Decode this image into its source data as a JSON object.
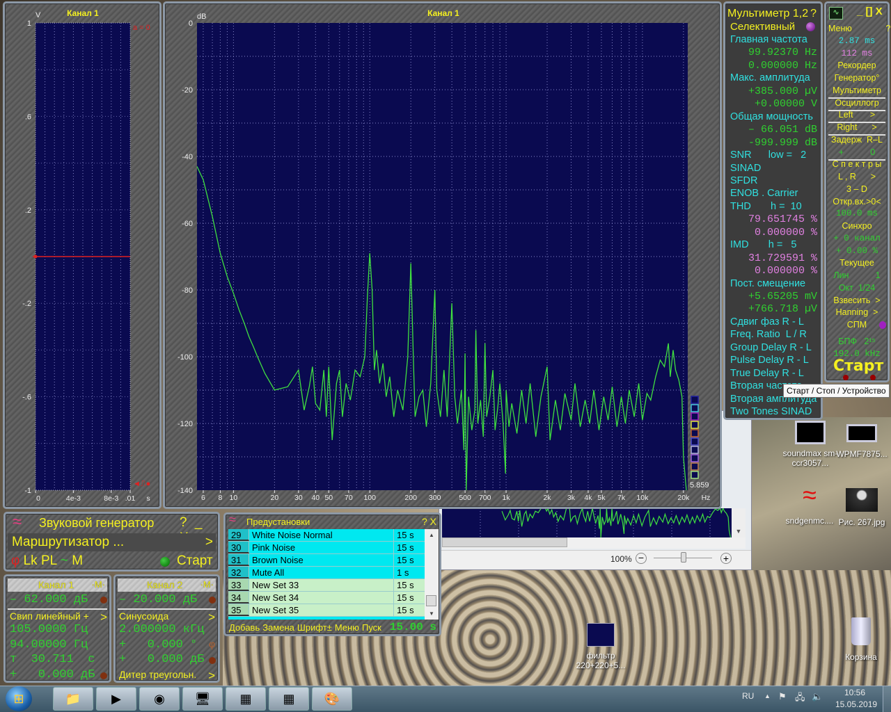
{
  "oscilloscope": {
    "title": "Канал 1",
    "unit_y": "V",
    "unit_x": "s",
    "y_ticks": [
      "1",
      ".6",
      ".2",
      "-.2",
      "-.6",
      "-1"
    ],
    "x_ticks": [
      "0",
      "4e-3",
      "8e-3",
      ".01"
    ],
    "trigger_label": "a = 0",
    "marker_label": "◄⎍●"
  },
  "spectrum": {
    "title": "Канал 1",
    "unit_y": "dB",
    "unit_x": "Hz",
    "y_ticks": [
      "0",
      "-20",
      "-40",
      "-60",
      "-80",
      "-100",
      "-120",
      "-140"
    ],
    "x_ticks": [
      "6",
      "8",
      "10",
      "20",
      "30",
      "40",
      "50",
      "70",
      "100",
      "200",
      "300",
      "500",
      "700",
      "1k",
      "2k",
      "3k",
      "4k",
      "5k",
      "7k",
      "10k",
      "20k"
    ],
    "corner_value": "5.859",
    "legend_colors": [
      "#2020a0",
      "#40c0e0",
      "#a020c0",
      "#e0e040",
      "#c06030",
      "#5050d0",
      "#b0b0e0",
      "#a060e0",
      "#c08050",
      "#a0e080"
    ]
  },
  "chart_data": {
    "type": "line",
    "title": "Канал 1",
    "ylabel": "dB",
    "xlabel": "Hz",
    "x_scale": "log",
    "xlim": [
      5.4,
      21500
    ],
    "ylim": [
      -140,
      0
    ],
    "grid": true,
    "line_color": "#40e040",
    "background": "#0a0a50",
    "points": [
      [
        5.4,
        -43
      ],
      [
        6,
        -47
      ],
      [
        7,
        -58
      ],
      [
        8,
        -69
      ],
      [
        9,
        -76
      ],
      [
        10,
        -81
      ],
      [
        11,
        -86
      ],
      [
        12,
        -90
      ],
      [
        13,
        -94
      ],
      [
        14,
        -97
      ],
      [
        15,
        -100
      ],
      [
        17,
        -105
      ],
      [
        20,
        -110
      ],
      [
        25,
        -109
      ],
      [
        30,
        -104
      ],
      [
        33,
        -116
      ],
      [
        36,
        -109
      ],
      [
        38,
        -103
      ],
      [
        40,
        -114
      ],
      [
        43,
        -116
      ],
      [
        46,
        -104
      ],
      [
        48,
        -118
      ],
      [
        50,
        -103
      ],
      [
        53,
        -125
      ],
      [
        57,
        -108
      ],
      [
        60,
        -104
      ],
      [
        63,
        -118
      ],
      [
        67,
        -108
      ],
      [
        72,
        -113
      ],
      [
        78,
        -104
      ],
      [
        85,
        -106
      ],
      [
        92,
        -100
      ],
      [
        96,
        -82
      ],
      [
        100,
        -69
      ],
      [
        104,
        -80
      ],
      [
        108,
        -104
      ],
      [
        112,
        -98
      ],
      [
        118,
        -108
      ],
      [
        125,
        -102
      ],
      [
        132,
        -112
      ],
      [
        140,
        -106
      ],
      [
        150,
        -118
      ],
      [
        160,
        -110
      ],
      [
        175,
        -116
      ],
      [
        190,
        -100
      ],
      [
        200,
        -72
      ],
      [
        208,
        -98
      ],
      [
        215,
        -118
      ],
      [
        230,
        -112
      ],
      [
        245,
        -110
      ],
      [
        260,
        -121
      ],
      [
        280,
        -108
      ],
      [
        300,
        -80
      ],
      [
        310,
        -110
      ],
      [
        330,
        -118
      ],
      [
        350,
        -104
      ],
      [
        370,
        -118
      ],
      [
        400,
        -84
      ],
      [
        420,
        -112
      ],
      [
        440,
        -120
      ],
      [
        470,
        -110
      ],
      [
        490,
        -128
      ],
      [
        500,
        -99
      ],
      [
        510,
        -140
      ],
      [
        530,
        -112
      ],
      [
        560,
        -122
      ],
      [
        590,
        -116
      ],
      [
        600,
        -92
      ],
      [
        620,
        -120
      ],
      [
        650,
        -113
      ],
      [
        680,
        -124
      ],
      [
        700,
        -96
      ],
      [
        720,
        -118
      ],
      [
        760,
        -112
      ],
      [
        800,
        -104
      ],
      [
        830,
        -122
      ],
      [
        870,
        -115
      ],
      [
        900,
        -108
      ],
      [
        950,
        -120
      ],
      [
        990,
        -135
      ],
      [
        1000,
        -110
      ],
      [
        1050,
        -121
      ],
      [
        1100,
        -114
      ],
      [
        1200,
        -123
      ],
      [
        1300,
        -110
      ],
      [
        1400,
        -120
      ],
      [
        1500,
        -108
      ],
      [
        1650,
        -124
      ],
      [
        1800,
        -112
      ],
      [
        2000,
        -103
      ],
      [
        2100,
        -125
      ],
      [
        2300,
        -113
      ],
      [
        2500,
        -122
      ],
      [
        2700,
        -111
      ],
      [
        3000,
        -119
      ],
      [
        3200,
        -108
      ],
      [
        3500,
        -121
      ],
      [
        3800,
        -113
      ],
      [
        4100,
        -120
      ],
      [
        4400,
        -110
      ],
      [
        4800,
        -122
      ],
      [
        5200,
        -112
      ],
      [
        5600,
        -119
      ],
      [
        6000,
        -109
      ],
      [
        6500,
        -121
      ],
      [
        7000,
        -112
      ],
      [
        7500,
        -120
      ],
      [
        8000,
        -110
      ],
      [
        8700,
        -118
      ],
      [
        9400,
        -108
      ],
      [
        10000,
        -119
      ],
      [
        10800,
        -111
      ],
      [
        11500,
        -113
      ],
      [
        12500,
        -106
      ],
      [
        13500,
        -101
      ],
      [
        14500,
        -103
      ],
      [
        15500,
        -96
      ],
      [
        16000,
        -106
      ],
      [
        16800,
        -98
      ],
      [
        17500,
        -104
      ],
      [
        18500,
        -107
      ],
      [
        19500,
        -112
      ],
      [
        20000,
        -130
      ],
      [
        21000,
        -142
      ]
    ]
  },
  "multimeter": {
    "title": "Мультиметр 1,2",
    "help": "?",
    "mode": "Селективный",
    "rows": [
      {
        "t": "Главная частота",
        "c": "c"
      },
      {
        "t": "99.92370 Hz",
        "c": "g",
        "v": 1
      },
      {
        "t": "0.000000 Hz",
        "c": "g",
        "v": 1
      },
      {
        "t": "Макс. амплитуда",
        "c": "c"
      },
      {
        "t": "+385.000 µV",
        "c": "g",
        "v": 1
      },
      {
        "t": "+0.00000 V",
        "c": "g",
        "v": 1
      },
      {
        "t": "Общая мощность",
        "c": "c"
      },
      {
        "t": "– 66.051 dB",
        "c": "g",
        "v": 1
      },
      {
        "t": "-999.999 dB",
        "c": "g",
        "v": 1
      },
      {
        "t": "SNR      low =   2",
        "c": "c"
      },
      {
        "t": "SINAD",
        "c": "c"
      },
      {
        "t": "SFDR",
        "c": "c"
      },
      {
        "t": "ENOB . Carrier",
        "c": "c"
      },
      {
        "t": "THD       h =  10",
        "c": "c"
      },
      {
        "t": "79.651745 %",
        "c": "p",
        "v": 1
      },
      {
        "t": "0.000000 %",
        "c": "p",
        "v": 1
      },
      {
        "t": "IMD       h =   5",
        "c": "c"
      },
      {
        "t": "31.729591 %",
        "c": "p",
        "v": 1
      },
      {
        "t": "0.000000 %",
        "c": "p",
        "v": 1
      },
      {
        "t": "Пост. смещение",
        "c": "c"
      },
      {
        "t": "+5.65205 mV",
        "c": "g",
        "v": 1
      },
      {
        "t": "+766.718 µV",
        "c": "g",
        "v": 1
      },
      {
        "t": "Сдвиг фаз R - L",
        "c": "c"
      },
      {
        "t": "Freq. Ratio  L / R",
        "c": "c"
      },
      {
        "t": "Group Delay R - L",
        "c": "c"
      },
      {
        "t": "Pulse Delay R - L",
        "c": "c"
      },
      {
        "t": "True Delay R - L",
        "c": "c"
      },
      {
        "t": "Вторая частота",
        "c": "c"
      },
      {
        "t": "Вторая амплитуда",
        "c": "c"
      },
      {
        "t": "Two Tones SINAD",
        "c": "c"
      }
    ]
  },
  "menu_panel": {
    "controls": "_ [] X",
    "rows": [
      {
        "t": "Меню              ?",
        "c": "y"
      },
      {
        "t": "2.87 ms",
        "c": "c",
        "v": 1
      },
      {
        "t": "112 ms",
        "c": "p",
        "v": 1
      },
      {
        "t": "Рекордер",
        "c": "y"
      },
      {
        "t": "Генератор°",
        "c": "y"
      },
      {
        "t": "Мультиметр",
        "c": "y",
        "line": 1
      },
      {
        "t": "Осциллогр",
        "c": "y",
        "line": 1
      },
      {
        "t": "Left       >",
        "c": "y",
        "line": 1
      },
      {
        "t": "Right      >",
        "c": "y",
        "line": 1
      },
      {
        "t": "Задерж  R–L",
        "c": "y"
      },
      {
        "t": "+           0",
        "c": "g",
        "line": 1
      },
      {
        "t": "С п е к т р ы",
        "c": "y"
      },
      {
        "t": "L , R      >",
        "c": "y"
      },
      {
        "t": "3 – D",
        "c": "y"
      },
      {
        "t": "Откр.вх.>0<",
        "c": "y"
      },
      {
        "t": "100.0 ms",
        "c": "g",
        "v": 1
      },
      {
        "t": "Синхро",
        "c": "y"
      },
      {
        "t": "+ 0 канал",
        "c": "g",
        "v": 1
      },
      {
        "t": "+ 0.00 %",
        "c": "g",
        "v": 1
      },
      {
        "t": "Текущее",
        "c": "y"
      },
      {
        "t": "Лин           1",
        "c": "g"
      },
      {
        "t": "Окт  1/24",
        "c": "g"
      },
      {
        "t": "Взвесить  >",
        "c": "y"
      },
      {
        "t": "Hanning  >",
        "c": "y"
      },
      {
        "t": "СПМ",
        "c": "y"
      },
      {
        "t": "БПФ   2¹⁵",
        "c": "g"
      },
      {
        "t": "192.0 kHz",
        "c": "g",
        "v": 1
      }
    ],
    "start_label": "Старт"
  },
  "tooltip": "Старт / Стоп / Устройство",
  "generator": {
    "title": "Звуковой генератор",
    "controls": "? _ X",
    "router": "Маршрутизатор ...",
    "router_arrow": ">",
    "mode_phi": "φ",
    "mode_lk": "Lk",
    "mode_pl": "PL",
    "mode_tilde": "~",
    "mode_m": "M",
    "start": "Старт",
    "ch1": {
      "title": "Канал 1",
      "m": "·M·",
      "level": "– 62.000 дБ",
      "wave": "Свип линейный +",
      "arrow": ">",
      "f1": "105.0000 Гц",
      "f2": "94.00000 Гц",
      "time": "т  30.711  с",
      "gain": "+   0.000 дБ"
    },
    "ch2": {
      "title": "Канал 2",
      "m": "·M·",
      "level": "– 20.000 дБ",
      "wave": "Синусоида",
      "arrow": ">",
      "freq": "2.000000 кГц",
      "phase": "+   0.000 °",
      "phase_icon": "φ",
      "gain": "+   0.000 дБ",
      "dither": "Дитер треугольн.",
      "dither_arrow": ">"
    }
  },
  "presets": {
    "title": "Предустановки",
    "controls": "? X",
    "rows": [
      {
        "n": "29",
        "name": "White Noise Normal",
        "t": "15 s",
        "sel": true
      },
      {
        "n": "30",
        "name": "Pink Noise",
        "t": "15 s",
        "sel": true
      },
      {
        "n": "31",
        "name": "Brown Noise",
        "t": "15 s",
        "sel": true
      },
      {
        "n": "32",
        "name": "Mute All",
        "t": "1 s",
        "sel": true
      },
      {
        "n": "33",
        "name": "New Set 33",
        "t": "15 s",
        "sel": false
      },
      {
        "n": "34",
        "name": "New Set 34",
        "t": "15 s",
        "sel": false
      },
      {
        "n": "35",
        "name": "New Set 35",
        "t": "15 s",
        "sel": false
      }
    ],
    "toolbar": [
      "Добавь",
      "Замена",
      "Шрифт±",
      "Меню",
      "Пуск"
    ],
    "duration": "15.00 s"
  },
  "viewer": {
    "zoom": "100%"
  },
  "desktop_icons": [
    {
      "label": "soundmax sm-ccr3057..."
    },
    {
      "label": "WPMF7875..."
    },
    {
      "label": "sndgenmc...."
    },
    {
      "label": "Рис. 267.jpg"
    },
    {
      "label": "фильтр 220+220+5..."
    },
    {
      "label": "Корзина"
    }
  ],
  "taskbar": {
    "lang": "RU",
    "time": "10:56",
    "date": "15.05.2019",
    "apps": [
      "file-explorer",
      "media-player",
      "chrome",
      "network-tool",
      "app-window-1",
      "app-window-2",
      "paint"
    ]
  }
}
